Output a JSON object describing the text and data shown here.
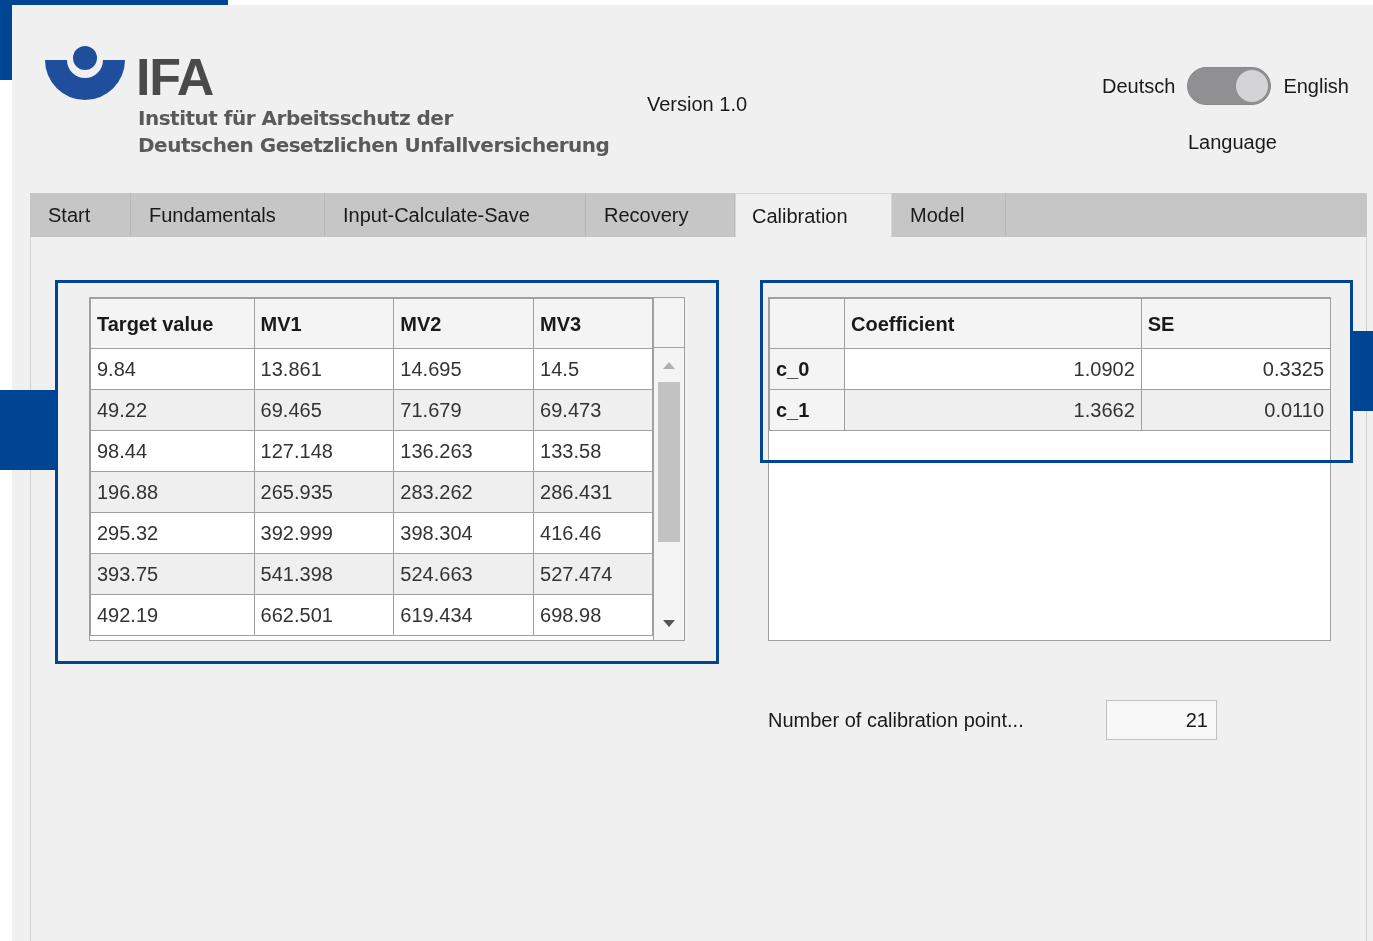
{
  "header": {
    "logo_text": "IFA",
    "institute_lines": [
      "Institut für Arbeitsschutz der",
      "Deutschen Gesetzlichen Unfallversicherung"
    ],
    "version": "Version 1.0"
  },
  "language": {
    "left_label": "Deutsch",
    "right_label": "English",
    "on": true,
    "caption": "Language"
  },
  "tabs": [
    {
      "label": "Start",
      "selected": false
    },
    {
      "label": "Fundamentals",
      "selected": false
    },
    {
      "label": "Input-Calculate-Save",
      "selected": false
    },
    {
      "label": "Recovery",
      "selected": false
    },
    {
      "label": "Calibration",
      "selected": true
    },
    {
      "label": "Model",
      "selected": false
    }
  ],
  "data_table": {
    "columns": [
      "Target value",
      "MV1",
      "MV2",
      "MV3"
    ],
    "rows": [
      [
        "9.84",
        "13.861",
        "14.695",
        "14.5"
      ],
      [
        "49.22",
        "69.465",
        "71.679",
        "69.473"
      ],
      [
        "98.44",
        "127.148",
        "136.263",
        "133.58"
      ],
      [
        "196.88",
        "265.935",
        "283.262",
        "286.431"
      ],
      [
        "295.32",
        "392.999",
        "398.304",
        "416.46"
      ],
      [
        "393.75",
        "541.398",
        "524.663",
        "527.474"
      ],
      [
        "492.19",
        "662.501",
        "619.434",
        "698.98"
      ]
    ]
  },
  "coefficient_table": {
    "columns": [
      "Coefficient",
      "SE"
    ],
    "rows": [
      {
        "name": "c_0",
        "values": [
          "1.0902",
          "0.3325"
        ]
      },
      {
        "name": "c_1",
        "values": [
          "1.3662",
          "0.0110"
        ]
      }
    ]
  },
  "calibration_points": {
    "label": "Number of calibration point...",
    "value": "21"
  }
}
